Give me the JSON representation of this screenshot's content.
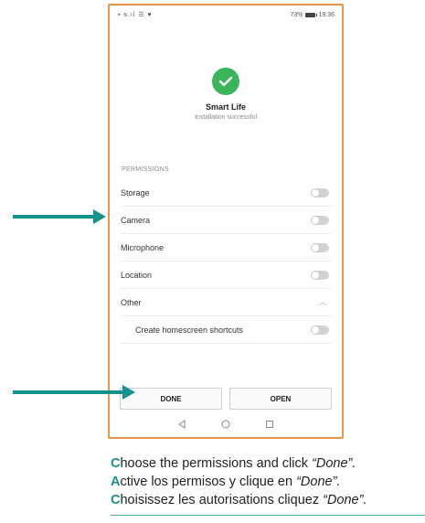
{
  "status_bar": {
    "left_icons": "▪ ᵴ.ıl ☰ ♥",
    "battery_percent": "73%",
    "time": "19:36"
  },
  "app": {
    "name": "Smart Life",
    "status": "Installation successful"
  },
  "permissions": {
    "header": "PERMISSIONS",
    "items": [
      {
        "label": "Storage",
        "enabled": false
      },
      {
        "label": "Camera",
        "enabled": false
      },
      {
        "label": "Microphone",
        "enabled": false
      },
      {
        "label": "Location",
        "enabled": false
      },
      {
        "label": "Other",
        "expanded": true
      },
      {
        "label": "Create homescreen shortcuts",
        "enabled": false
      }
    ]
  },
  "buttons": {
    "done": "DONE",
    "open": "OPEN"
  },
  "nav_icons": [
    "back-icon",
    "home-icon",
    "recents-icon"
  ],
  "instructions": [
    {
      "initial": "C",
      "text": "hoose the permissions and click ",
      "emph": "“Done”."
    },
    {
      "initial": "A",
      "text": "ctive los permisos y clique en ",
      "emph": "“Done”."
    },
    {
      "initial": "C",
      "text": "hoisissez les autorisations cliquez ",
      "emph": "“Done”."
    }
  ],
  "colors": {
    "accent": "#14928d",
    "phone_border": "#e8974a",
    "success": "#3bb55c"
  }
}
